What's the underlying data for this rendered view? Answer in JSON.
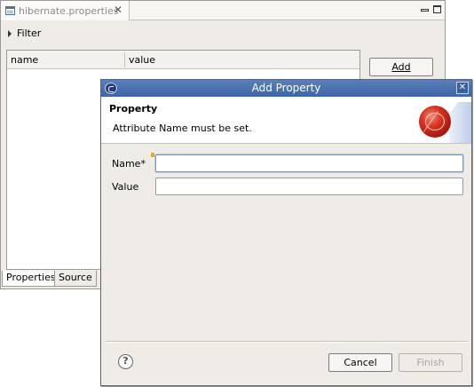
{
  "editor": {
    "tab_title": "hibernate.properties",
    "filter_label": "Filter",
    "table": {
      "columns": [
        "name",
        "value"
      ]
    },
    "add_button": "Add",
    "bottom_tabs": [
      "Properties",
      "Source"
    ]
  },
  "dialog": {
    "title": "Add Property",
    "banner": {
      "heading": "Property",
      "message": "Attribute Name must be set."
    },
    "fields": {
      "name_label": "Name*",
      "name_value": "",
      "value_label": "Value",
      "value_value": ""
    },
    "buttons": {
      "cancel": "Cancel",
      "finish": "Finish"
    },
    "help_glyph": "?",
    "close_glyph": "✕"
  },
  "colors": {
    "titlebar": "#3d66a8",
    "dialog_bg": "#efebe7",
    "focus_border": "#7a99c7",
    "banner_graphic": "#d8321e"
  },
  "icons": {
    "editor_tab": "properties-file-icon",
    "tab_close": "close-icon",
    "filter": "triangle-right-icon",
    "dialog": "eclipse-icon",
    "help": "help-icon",
    "banner": "wizard-banner-icon"
  }
}
